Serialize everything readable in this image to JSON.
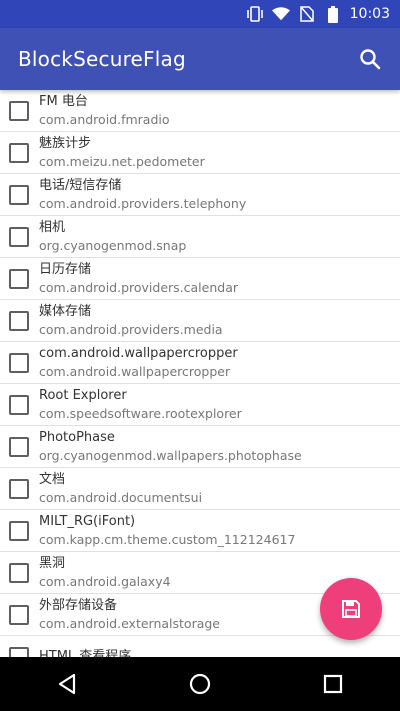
{
  "status_bar": {
    "time": "10:03",
    "icons": [
      "vibrate-icon",
      "wifi-icon",
      "no-sim-icon",
      "battery-icon"
    ]
  },
  "app_bar": {
    "title": "BlockSecureFlag",
    "search_icon": "search-icon"
  },
  "apps": [
    {
      "name": "FM 电台",
      "package": "com.android.fmradio"
    },
    {
      "name": "魅族计步",
      "package": "com.meizu.net.pedometer"
    },
    {
      "name": "电话/短信存储",
      "package": "com.android.providers.telephony"
    },
    {
      "name": "相机",
      "package": "org.cyanogenmod.snap"
    },
    {
      "name": "日历存储",
      "package": "com.android.providers.calendar"
    },
    {
      "name": "媒体存储",
      "package": "com.android.providers.media"
    },
    {
      "name": "com.android.wallpapercropper",
      "package": "com.android.wallpapercropper"
    },
    {
      "name": "Root Explorer",
      "package": "com.speedsoftware.rootexplorer"
    },
    {
      "name": "PhotoPhase",
      "package": "org.cyanogenmod.wallpapers.photophase"
    },
    {
      "name": "文档",
      "package": "com.android.documentsui"
    },
    {
      "name": "MILT_RG(iFont)",
      "package": "com.kapp.cm.theme.custom_112124617"
    },
    {
      "name": "黑洞",
      "package": "com.android.galaxy4"
    },
    {
      "name": "外部存储设备",
      "package": "com.android.externalstorage"
    },
    {
      "name": "HTML 查看程序",
      "package": ""
    }
  ],
  "fab": {
    "icon": "save-icon"
  },
  "nav_bar": {
    "icons": [
      "back-icon",
      "home-icon",
      "recents-icon"
    ]
  },
  "colors": {
    "app_bar": "#3f51b5",
    "status_bar": "#3046b8",
    "fab": "#ee3f7a"
  }
}
